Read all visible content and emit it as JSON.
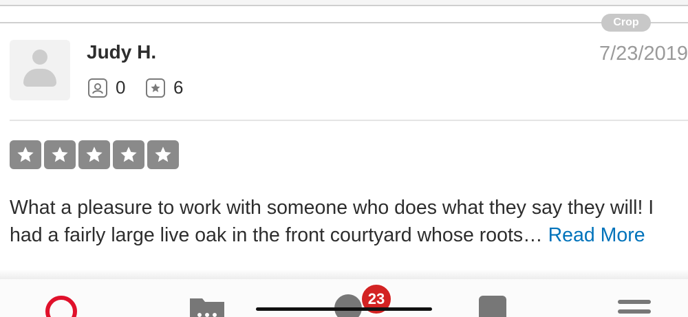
{
  "crop_button": {
    "label": "Crop"
  },
  "review": {
    "user_name": "Judy H.",
    "date": "7/23/2019",
    "friends_count": "0",
    "reviews_count": "6",
    "rating": 5,
    "text": "What a pleasure to work with someone who does what they say they will!  I had a fairly large live oak in the front courtyard whose roots…",
    "read_more": "Read More"
  },
  "tab_bar": {
    "items": [
      {
        "name": "search",
        "icon": "search-icon"
      },
      {
        "name": "collections",
        "icon": "folder-icon"
      },
      {
        "name": "me",
        "icon": "user-icon"
      },
      {
        "name": "bookmarks",
        "icon": "bookmark-icon"
      },
      {
        "name": "more",
        "icon": "menu-icon"
      }
    ],
    "notification_badge": "23"
  },
  "colors": {
    "accent_red": "#d32323",
    "link_blue": "#0073bb",
    "star_gray": "#8a8a8a"
  }
}
